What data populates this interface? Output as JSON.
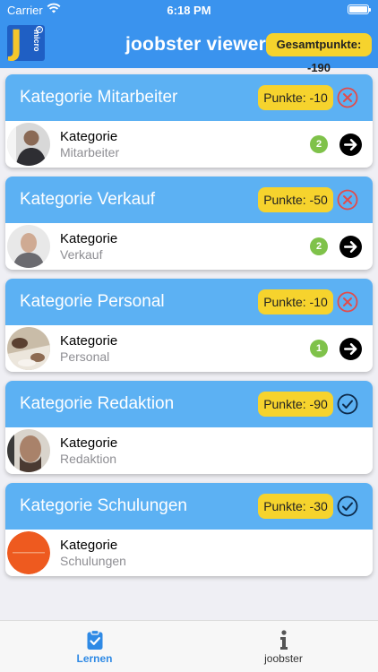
{
  "status_bar": {
    "carrier": "Carrier",
    "time": "6:18 PM"
  },
  "header": {
    "logo_letter": "J",
    "logo_sub": "micro",
    "title": "joobster viewer",
    "total_points": "Gesamtpunkte: -190"
  },
  "categories": [
    {
      "title": "Kategorie Mitarbeiter",
      "points": "Punkte: -10",
      "status": "x-circle-icon",
      "row_title": "Kategorie",
      "row_sub": "Mitarbeiter",
      "count": "2",
      "has_arrow": true
    },
    {
      "title": "Kategorie Verkauf",
      "points": "Punkte: -50",
      "status": "x-circle-icon",
      "row_title": "Kategorie",
      "row_sub": "Verkauf",
      "count": "2",
      "has_arrow": true
    },
    {
      "title": "Kategorie Personal",
      "points": "Punkte: -10",
      "status": "x-circle-icon",
      "row_title": "Kategorie",
      "row_sub": "Personal",
      "count": "1",
      "has_arrow": true
    },
    {
      "title": "Kategorie Redaktion",
      "points": "Punkte: -90",
      "status": "check-circle-icon",
      "row_title": "Kategorie",
      "row_sub": "Redaktion",
      "count": "",
      "has_arrow": false
    },
    {
      "title": "Kategorie Schulungen",
      "points": "Punkte: -30",
      "status": "check-circle-icon",
      "row_title": "Kategorie",
      "row_sub": "Schulungen",
      "count": "",
      "has_arrow": false
    }
  ],
  "tabs": [
    {
      "label": "Lernen",
      "icon": "clipboard-check-icon",
      "active": true
    },
    {
      "label": "joobster",
      "icon": "info-icon",
      "active": false
    }
  ],
  "colors": {
    "header": "#3a93ee",
    "card_header": "#5cb1f3",
    "badge": "#f6d32d",
    "count": "#7fc24a",
    "error": "#e24b4b",
    "ok": "#0d2a4a"
  }
}
